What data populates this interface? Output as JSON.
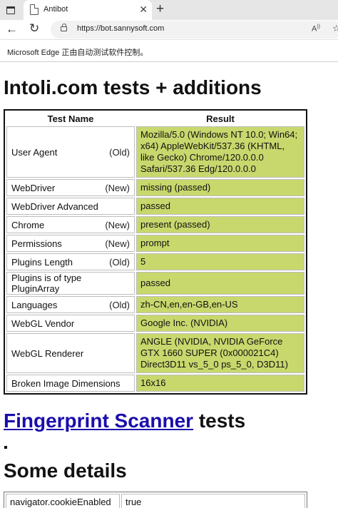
{
  "browser": {
    "tab_title": "Antibot",
    "tab_close": "✕",
    "new_tab": "+",
    "url": "https://bot.sannysoft.com",
    "read_aloud": "A",
    "infobar": "Microsoft Edge 正由自动测试软件控制。"
  },
  "page": {
    "heading1": "Intoli.com tests + additions",
    "heading2_link": "Fingerprint Scanner",
    "heading2_rest": " tests",
    "heading3": "Some details"
  },
  "results_table": {
    "headers": [
      "Test Name",
      "Result"
    ],
    "rows": [
      {
        "name": "User Agent",
        "version": "(Old)",
        "result": "Mozilla/5.0 (Windows NT 10.0; Win64; x64) AppleWebKit/537.36 (KHTML, like Gecko) Chrome/120.0.0.0 Safari/537.36 Edg/120.0.0.0"
      },
      {
        "name": "WebDriver",
        "version": "(New)",
        "result": "missing (passed)"
      },
      {
        "name": "WebDriver Advanced",
        "version": "",
        "result": "passed"
      },
      {
        "name": "Chrome",
        "version": "(New)",
        "result": "present (passed)"
      },
      {
        "name": "Permissions",
        "version": "(New)",
        "result": "prompt"
      },
      {
        "name": "Plugins Length",
        "version": "(Old)",
        "result": "5"
      },
      {
        "name": "Plugins is of type PluginArray",
        "version": "",
        "result": "passed"
      },
      {
        "name": "Languages",
        "version": "(Old)",
        "result": "zh-CN,en,en-GB,en-US"
      },
      {
        "name": "WebGL Vendor",
        "version": "",
        "result": "Google Inc. (NVIDIA)"
      },
      {
        "name": "WebGL Renderer",
        "version": "",
        "result": "ANGLE (NVIDIA, NVIDIA GeForce GTX 1660 SUPER (0x000021C4) Direct3D11 vs_5_0 ps_5_0, D3D11)"
      },
      {
        "name": "Broken Image Dimensions",
        "version": "",
        "result": "16x16"
      }
    ]
  },
  "details_table": {
    "rows": [
      {
        "key": "navigator.cookieEnabled",
        "value": "true"
      }
    ]
  },
  "colors": {
    "passed_bg": "#c8d86d",
    "link": "#1a0dab"
  }
}
